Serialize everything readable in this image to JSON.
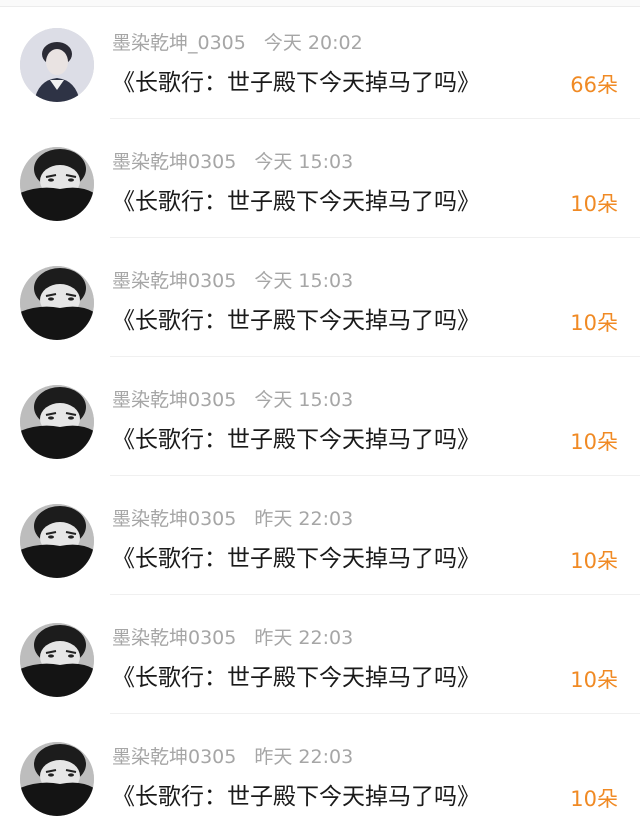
{
  "messages": [
    {
      "user": "墨染乾坤_0305",
      "time": "今天 20:02",
      "title": "《长歌行：世子殿下今天掉马了吗》",
      "count": "66朵",
      "avatar": "portrait-light"
    },
    {
      "user": "墨染乾坤0305",
      "time": "今天 15:03",
      "title": "《长歌行：世子殿下今天掉马了吗》",
      "count": "10朵",
      "avatar": "portrait-mask"
    },
    {
      "user": "墨染乾坤0305",
      "time": "今天 15:03",
      "title": "《长歌行：世子殿下今天掉马了吗》",
      "count": "10朵",
      "avatar": "portrait-mask"
    },
    {
      "user": "墨染乾坤0305",
      "time": "今天 15:03",
      "title": "《长歌行：世子殿下今天掉马了吗》",
      "count": "10朵",
      "avatar": "portrait-mask"
    },
    {
      "user": "墨染乾坤0305",
      "time": "昨天 22:03",
      "title": "《长歌行：世子殿下今天掉马了吗》",
      "count": "10朵",
      "avatar": "portrait-mask"
    },
    {
      "user": "墨染乾坤0305",
      "time": "昨天 22:03",
      "title": "《长歌行：世子殿下今天掉马了吗》",
      "count": "10朵",
      "avatar": "portrait-mask"
    },
    {
      "user": "墨染乾坤0305",
      "time": "昨天 22:03",
      "title": "《长歌行：世子殿下今天掉马了吗》",
      "count": "10朵",
      "avatar": "portrait-mask"
    }
  ],
  "colors": {
    "count": "#f08a24",
    "meta": "#a6a6a6",
    "title": "#1a1a1a"
  }
}
